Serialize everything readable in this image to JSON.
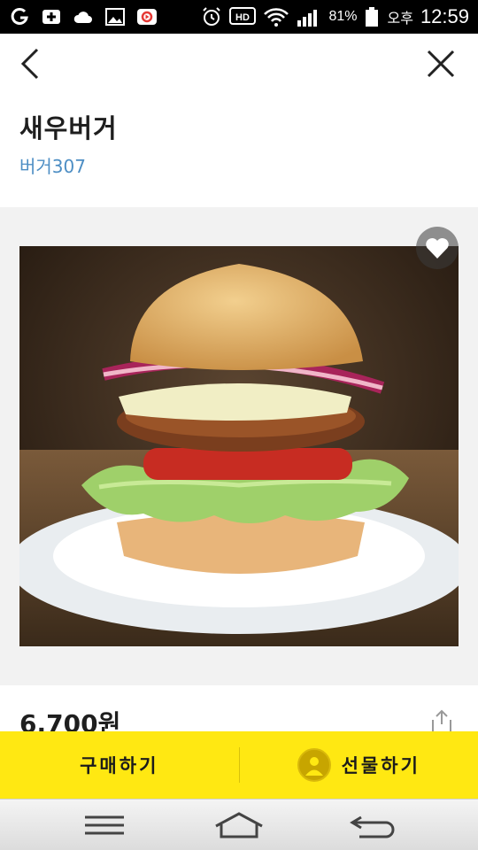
{
  "status_bar": {
    "battery": "81%",
    "ampm": "오후",
    "time": "12:59",
    "icons": [
      "g-icon",
      "plus-icon",
      "cloud-icon",
      "image-icon",
      "record-icon",
      "alarm-icon",
      "hd-voice-icon",
      "wifi-icon",
      "signal-icon",
      "battery-icon"
    ]
  },
  "nav": {
    "back_icon": "chevron-left-icon",
    "close_icon": "close-icon"
  },
  "product": {
    "name": "새우버거",
    "brand": "버거307",
    "price": "6,700원",
    "image_alt": "burger-photo"
  },
  "actions": {
    "buy_label": "구매하기",
    "gift_label": "선물하기"
  },
  "colors": {
    "accent_yellow": "#ffe812",
    "brand_link": "#4d8ec4"
  }
}
